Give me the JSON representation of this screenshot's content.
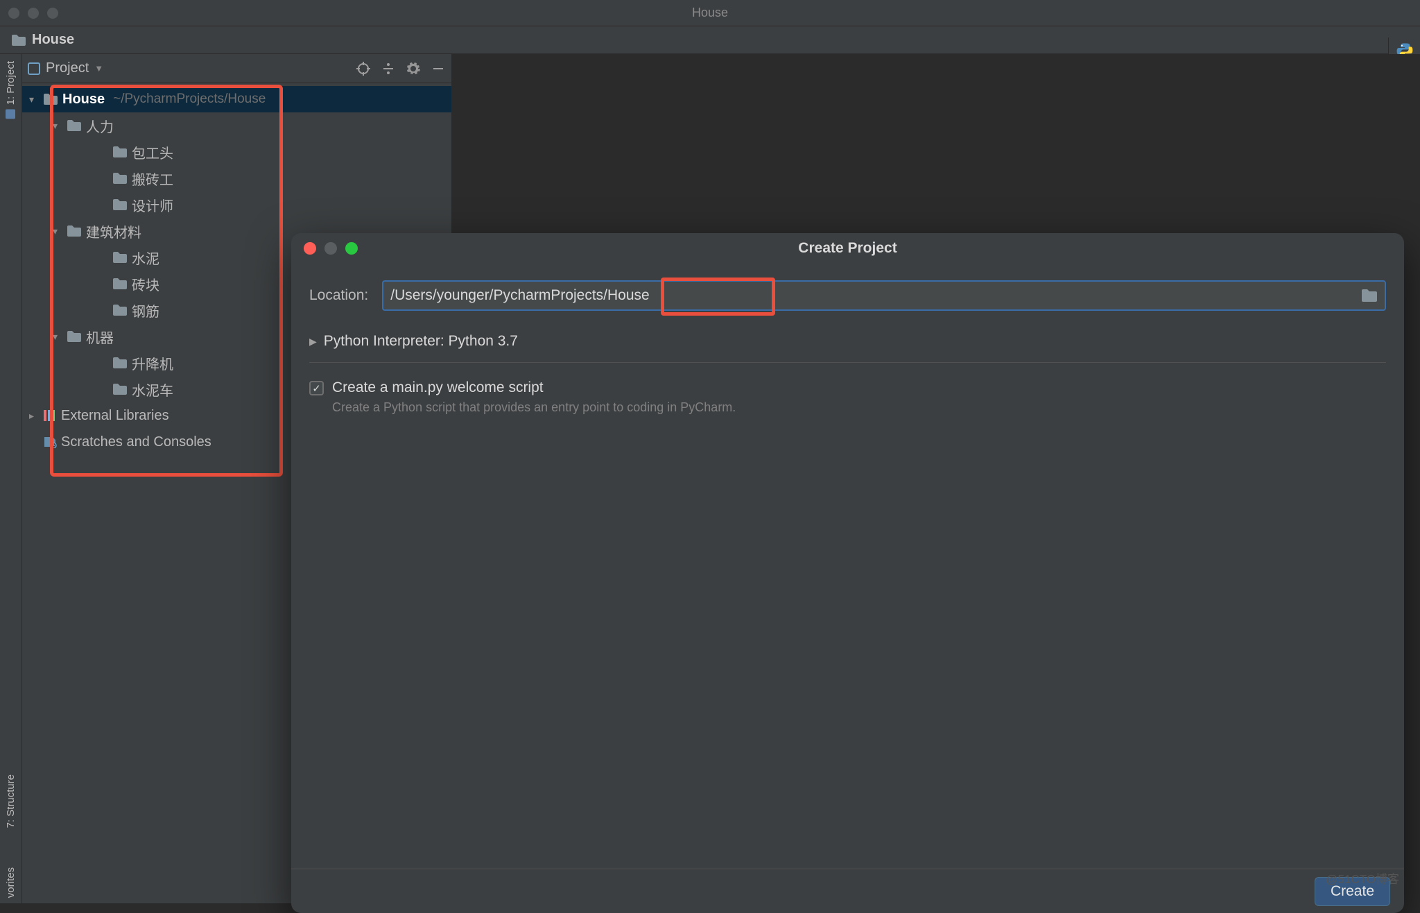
{
  "window": {
    "title": "House"
  },
  "breadcrumb": {
    "project_name": "House"
  },
  "side_tabs": {
    "project": "1: Project",
    "structure": "7: Structure",
    "favorites": "vorites"
  },
  "project_panel": {
    "header_label": "Project",
    "root": {
      "name": "House",
      "path": "~/PycharmProjects/House"
    },
    "tree": {
      "g1": {
        "name": "人力",
        "c1": "包工头",
        "c2": "搬砖工",
        "c3": "设计师"
      },
      "g2": {
        "name": "建筑材料",
        "c1": "水泥",
        "c2": "砖块",
        "c3": "钢筋"
      },
      "g3": {
        "name": "机器",
        "c1": "升降机",
        "c2": "水泥车"
      }
    },
    "ext_libs": "External Libraries",
    "scratches": "Scratches and Consoles"
  },
  "dialog": {
    "title": "Create Project",
    "location_label": "Location:",
    "location_value": "/Users/younger/PycharmProjects/House",
    "interpreter_label": "Python Interpreter: Python 3.7",
    "create_script_label": "Create a main.py welcome script",
    "create_script_desc": "Create a Python script that provides an entry point to coding in PyCharm.",
    "create_button": "Create"
  },
  "watermark": "@51CTO博客"
}
